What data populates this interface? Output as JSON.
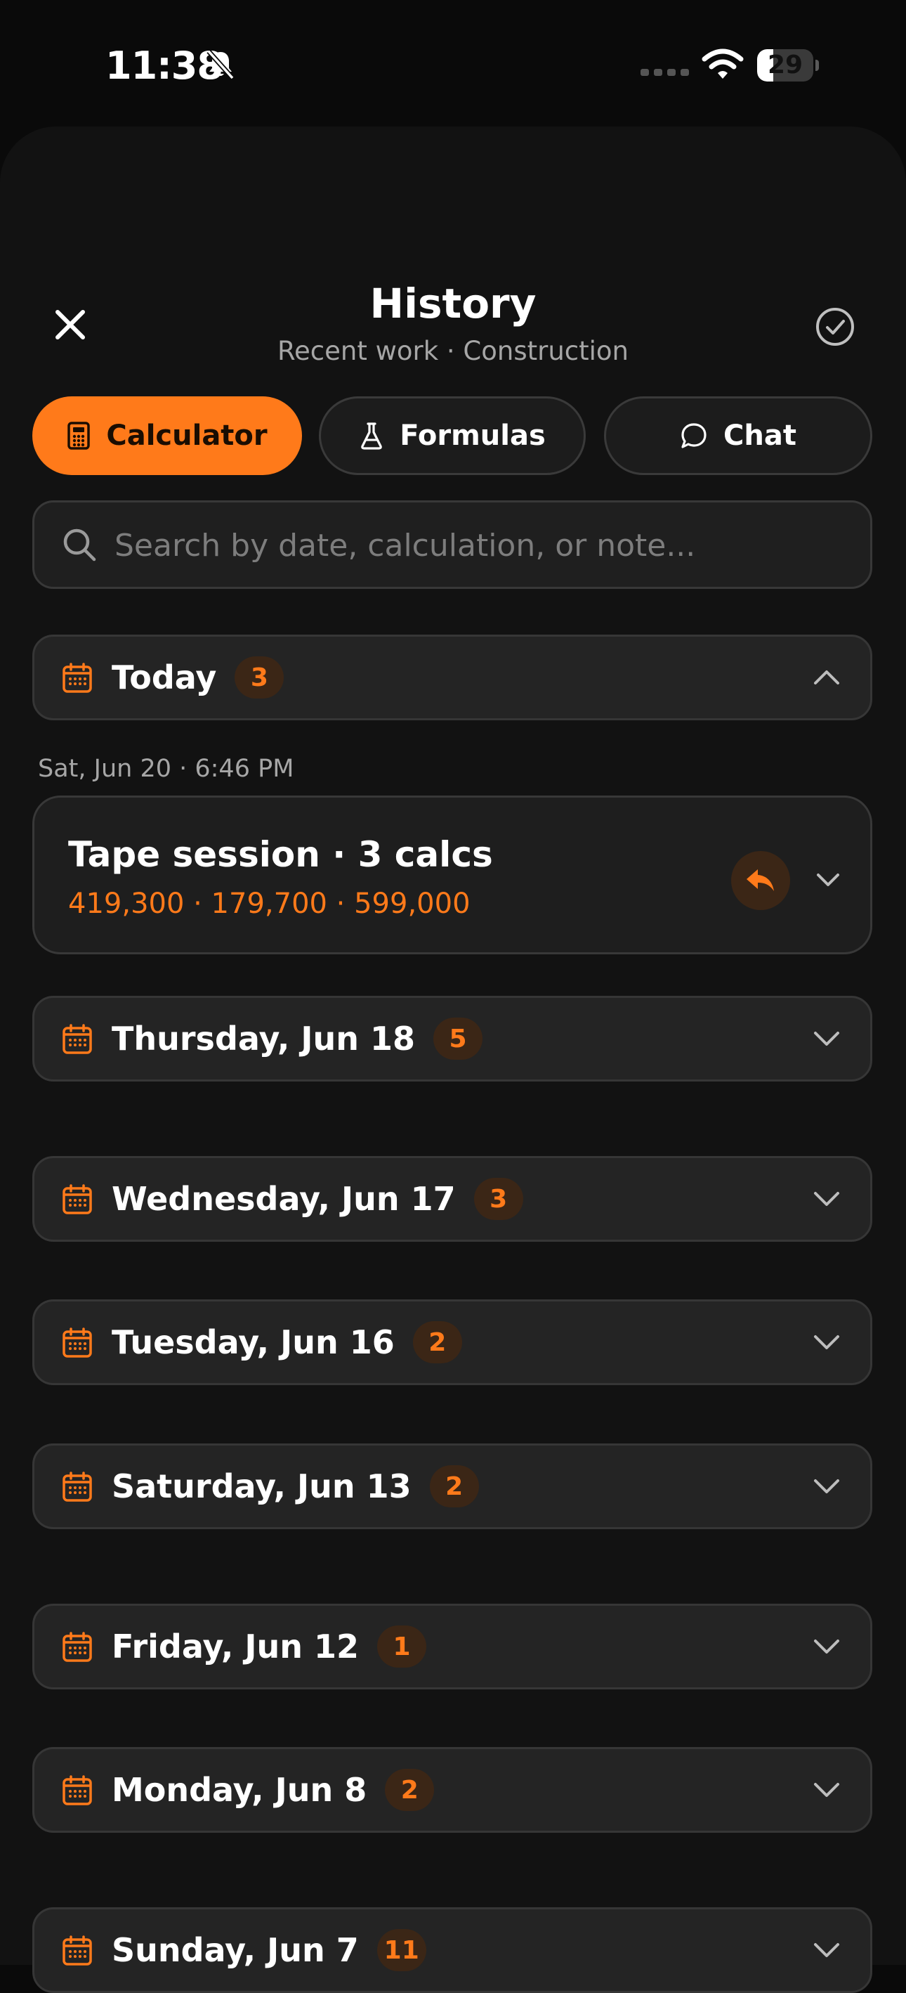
{
  "status_bar": {
    "time": "11:38",
    "battery": "29",
    "battery_level": 0.29
  },
  "header": {
    "title": "History",
    "subtitle": "Recent work · Construction",
    "close_icon": "close-icon",
    "done_icon": "check-circle-icon"
  },
  "tabs": [
    {
      "label": "Calculator",
      "icon": "calculator-icon",
      "active": true
    },
    {
      "label": "Formulas",
      "icon": "flask-icon",
      "active": false
    },
    {
      "label": "Chat",
      "icon": "chat-bubble-icon",
      "active": false
    }
  ],
  "search": {
    "placeholder": "Search by date, calculation, or note...",
    "value": ""
  },
  "groups": [
    {
      "label": "Today",
      "count": "3",
      "expanded": true
    },
    {
      "label": "Thursday, Jun 18",
      "count": "5",
      "expanded": false
    },
    {
      "label": "Wednesday, Jun 17",
      "count": "3",
      "expanded": false
    },
    {
      "label": "Tuesday, Jun 16",
      "count": "2",
      "expanded": false
    },
    {
      "label": "Saturday, Jun 13",
      "count": "2",
      "expanded": false
    },
    {
      "label": "Friday, Jun 12",
      "count": "1",
      "expanded": false
    },
    {
      "label": "Monday, Jun 8",
      "count": "2",
      "expanded": false
    },
    {
      "label": "Sunday, Jun 7",
      "count": "11",
      "expanded": false
    }
  ],
  "session": {
    "timestamp": "Sat, Jun 20 · 6:46 PM",
    "title": "Tape session · 3 calcs",
    "values": "419,300 · 179,700 · 599,000"
  },
  "colors": {
    "accent": "#ff7a1a",
    "background": "#0a0a0a",
    "sheet": "#121212",
    "card": "#242424"
  }
}
